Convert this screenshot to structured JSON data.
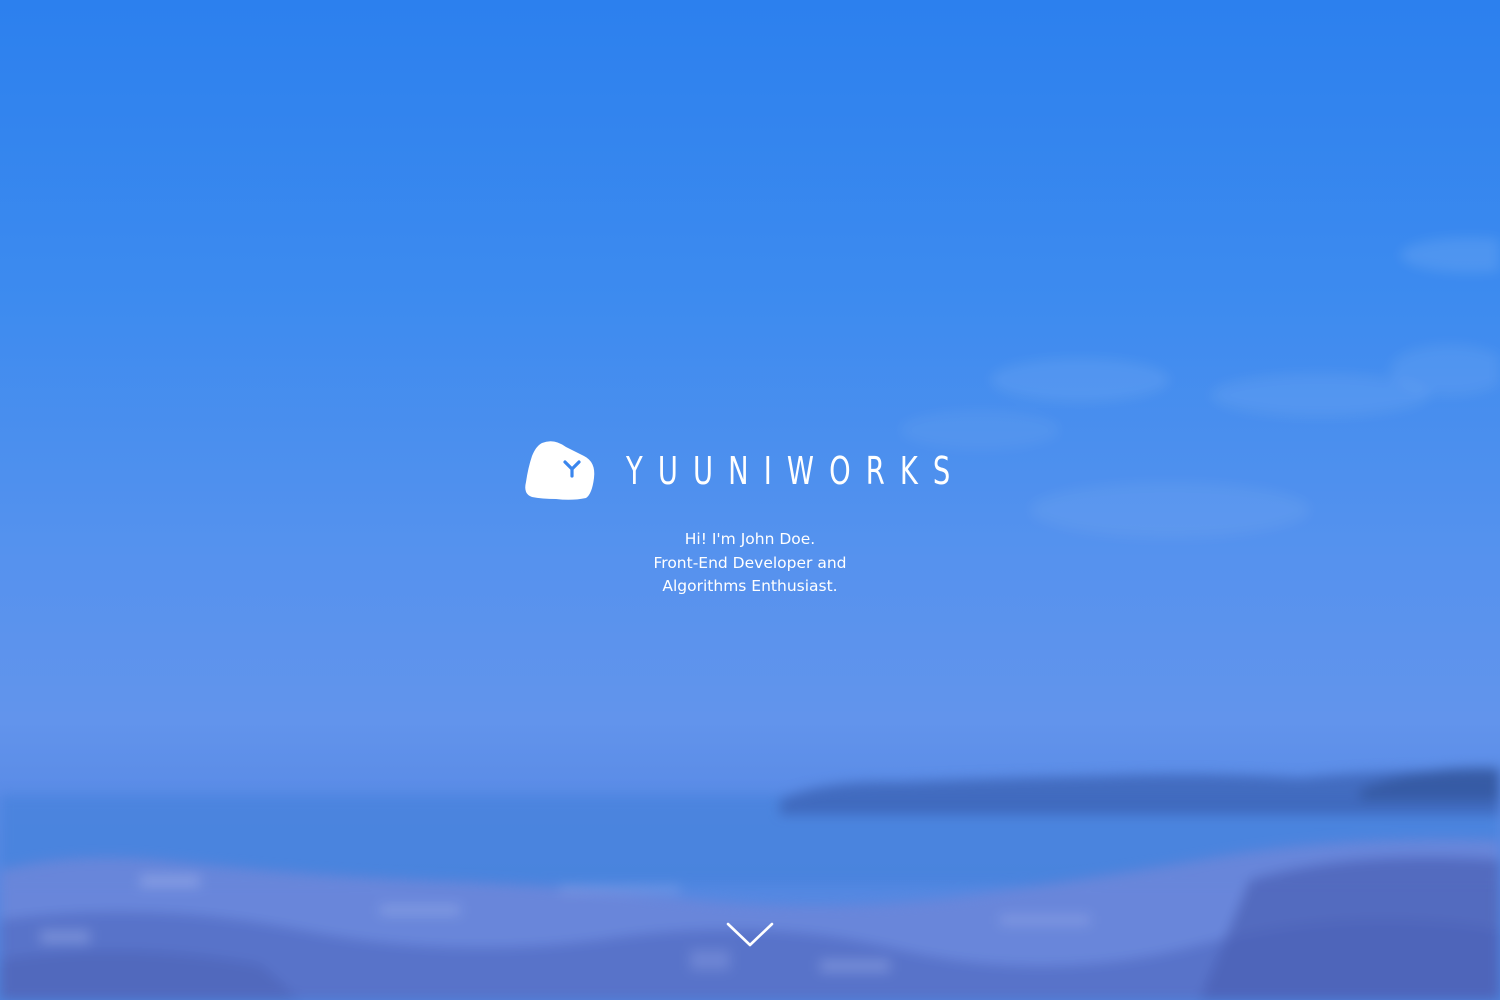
{
  "hero": {
    "brand": {
      "icon": "rock-logo-icon",
      "name": "YUUNIWORKS"
    },
    "tagline": [
      "Hi! I'm John Doe.",
      "Front-End Developer and",
      "Algorithms Enthusiast."
    ],
    "scroll_icon": "chevron-down-icon",
    "background": "blurred-coastal-landscape",
    "colors": {
      "sky_top": "#2c80ee",
      "sky_bottom": "#6294ec",
      "text": "#ffffff",
      "logo_accent": "#3a86ee"
    }
  }
}
